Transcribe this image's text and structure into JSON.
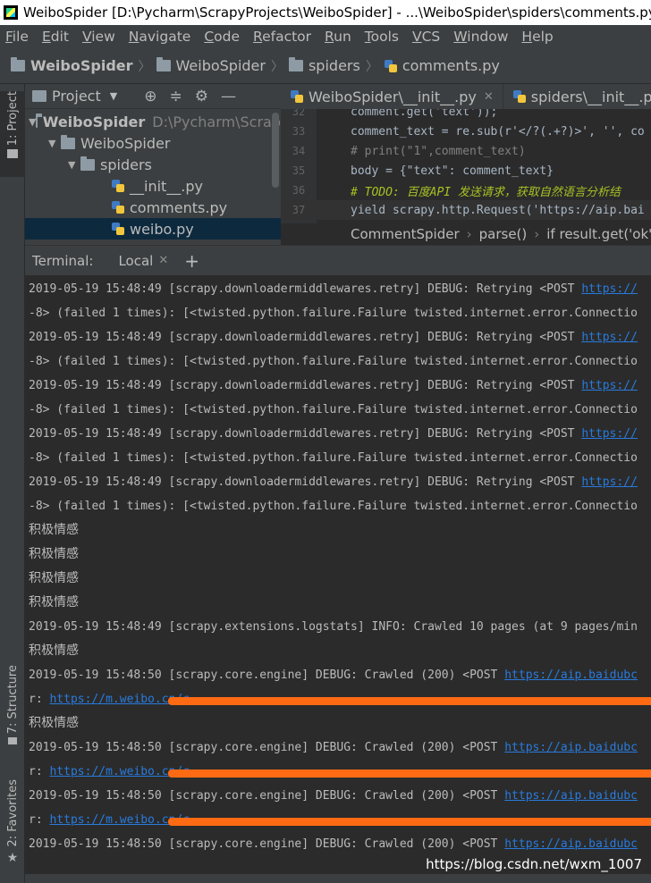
{
  "window": {
    "title": "WeiboSpider [D:\\Pycharm\\ScrapyProjects\\WeiboSpider] - ...\\WeiboSpider\\spiders\\comments.py [W"
  },
  "menu": [
    "File",
    "Edit",
    "View",
    "Navigate",
    "Code",
    "Refactor",
    "Run",
    "Tools",
    "VCS",
    "Window",
    "Help"
  ],
  "navbar": {
    "crumbs": [
      "WeiboSpider",
      "WeiboSpider",
      "spiders",
      "comments.py"
    ]
  },
  "left_stripe": {
    "project_tab": "1: Project",
    "structure_tab": "7: Structure",
    "favorites_tab": "2: Favorites"
  },
  "project_panel": {
    "title": "Project",
    "tree": [
      {
        "label": "WeiboSpider",
        "path": "D:\\Pycharm\\Scrap",
        "kind": "folder",
        "expanded": true
      },
      {
        "label": "WeiboSpider",
        "kind": "folder",
        "expanded": true
      },
      {
        "label": "spiders",
        "kind": "folder",
        "expanded": true
      },
      {
        "label": "__init__.py",
        "kind": "python"
      },
      {
        "label": "comments.py",
        "kind": "python"
      },
      {
        "label": "weibo.py",
        "kind": "python",
        "selected": true
      }
    ]
  },
  "editor": {
    "tabs": [
      "WeiboSpider\\__init__.py",
      "spiders\\__init__.py"
    ],
    "lines": [
      {
        "n": "32",
        "text": "comment.get('text'));"
      },
      {
        "n": "33",
        "text": "comment_text = re.sub(r'</?(.+?)>', '', co"
      },
      {
        "n": "34",
        "text": "# print(\"1\",comment_text)"
      },
      {
        "n": "35",
        "text": "body = {\"text\": comment_text}"
      },
      {
        "n": "36",
        "text": "# TODO: 百度API 发送请求，获取自然语言分析结"
      },
      {
        "n": "37",
        "text": "yield scrapy.http.Request('https://aip.bai"
      }
    ],
    "crumbs": [
      "CommentSpider",
      "parse()",
      "if result.get('ok')"
    ]
  },
  "terminal": {
    "label": "Terminal:",
    "tab": "Local",
    "add_symbol": "+",
    "lines": [
      {
        "text": "2019-05-19 15:48:49 [scrapy.downloadermiddlewares.retry] DEBUG: Retrying <POST ",
        "link": "https://"
      },
      {
        "text": "-8> (failed 1 times): [<twisted.python.failure.Failure twisted.internet.error.Connectio"
      },
      {
        "text": "2019-05-19 15:48:49 [scrapy.downloadermiddlewares.retry] DEBUG: Retrying <POST ",
        "link": "https://"
      },
      {
        "text": "-8> (failed 1 times): [<twisted.python.failure.Failure twisted.internet.error.Connectio"
      },
      {
        "text": "2019-05-19 15:48:49 [scrapy.downloadermiddlewares.retry] DEBUG: Retrying <POST ",
        "link": "https://"
      },
      {
        "text": "-8> (failed 1 times): [<twisted.python.failure.Failure twisted.internet.error.Connectio"
      },
      {
        "text": "2019-05-19 15:48:49 [scrapy.downloadermiddlewares.retry] DEBUG: Retrying <POST ",
        "link": "https://"
      },
      {
        "text": "-8> (failed 1 times): [<twisted.python.failure.Failure twisted.internet.error.Connectio"
      },
      {
        "text": "2019-05-19 15:48:49 [scrapy.downloadermiddlewares.retry] DEBUG: Retrying <POST ",
        "link": "https://"
      },
      {
        "text": "-8> (failed 1 times): [<twisted.python.failure.Failure twisted.internet.error.Connectio"
      },
      {
        "text": "积极情感",
        "cjk": true
      },
      {
        "text": "积极情感",
        "cjk": true
      },
      {
        "text": "积极情感",
        "cjk": true
      },
      {
        "text": "积极情感",
        "cjk": true
      },
      {
        "text": "2019-05-19 15:48:49 [scrapy.extensions.logstats] INFO: Crawled 10 pages (at 9 pages/min"
      },
      {
        "text": "积极情感",
        "cjk": true
      },
      {
        "text": "2019-05-19 15:48:50 [scrapy.core.engine] DEBUG: Crawled (200) <POST ",
        "link": "https://aip.baidubc"
      },
      {
        "text": "r: ",
        "link": "https://m.weibo.cn/c",
        "redacted": true
      },
      {
        "text": "积极情感",
        "cjk": true
      },
      {
        "text": "2019-05-19 15:48:50 [scrapy.core.engine] DEBUG: Crawled (200) <POST ",
        "link": "https://aip.baidubc"
      },
      {
        "text": "r: ",
        "link": "https://m.weibo.cn/c",
        "redacted": true
      },
      {
        "text": "2019-05-19 15:48:50 [scrapy.core.engine] DEBUG: Crawled (200) <POST ",
        "link": "https://aip.baidubc"
      },
      {
        "text": "r: ",
        "link": "https://m.weibo.cn/c",
        "redacted": true
      },
      {
        "text": "2019-05-19 15:48:50 [scrapy.core.engine] DEBUG: Crawled (200) <POST ",
        "link": "https://aip.baidubc"
      }
    ]
  },
  "watermark": "https://blog.csdn.net/wxm_1007",
  "colors": {
    "background": "#2b2b2b",
    "panel": "#3c3f41",
    "link": "#287bde",
    "redaction": "#ff6a13",
    "selection": "#0d293e"
  }
}
